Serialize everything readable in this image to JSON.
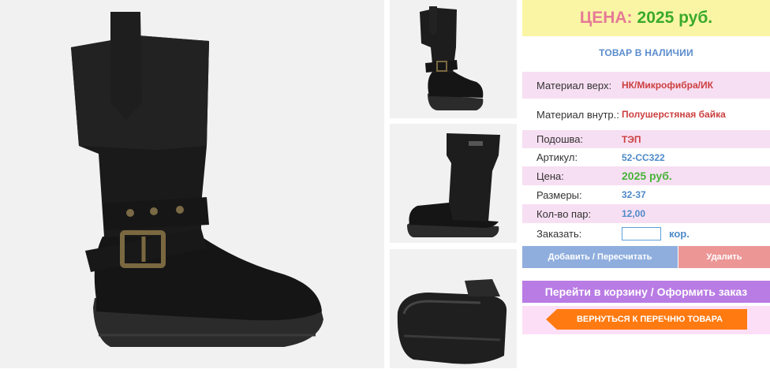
{
  "price_header": {
    "label": "ЦЕНА:",
    "value": "2025 руб."
  },
  "stock_status": "ТОВАР В НАЛИЧИИ",
  "specs": [
    {
      "label": "Материал верх:",
      "value": "НК/Микрофибра/ИК"
    },
    {
      "label": "Материал внутр.:",
      "value": "Полушерстяная байка"
    },
    {
      "label": "Подошва:",
      "value": "ТЭП"
    },
    {
      "label": "Артикул:",
      "value": "52-СС322"
    },
    {
      "label": "Цена:",
      "value": "2025 руб."
    },
    {
      "label": "Размеры:",
      "value": "32-37"
    },
    {
      "label": "Кол-во пар:",
      "value": "12,00"
    }
  ],
  "order": {
    "label": "Заказать:",
    "quantity_value": "",
    "unit": "кор."
  },
  "buttons": {
    "add": "Добавить / Пересчитать",
    "delete": "Удалить",
    "cart": "Перейти в корзину / Оформить заказ",
    "back": "ВЕРНУТЬСЯ К ПЕРЕЧНЮ ТОВАРА"
  },
  "colors": {
    "price_bg": "#faf5a5",
    "price_label": "#e67a96",
    "price_value": "#3aaa2a",
    "spec_row_pink": "#f7dff3",
    "add_button": "#8faede",
    "delete_button": "#ec9696",
    "cart_button": "#b97be4",
    "back_button": "#ff7a10"
  }
}
